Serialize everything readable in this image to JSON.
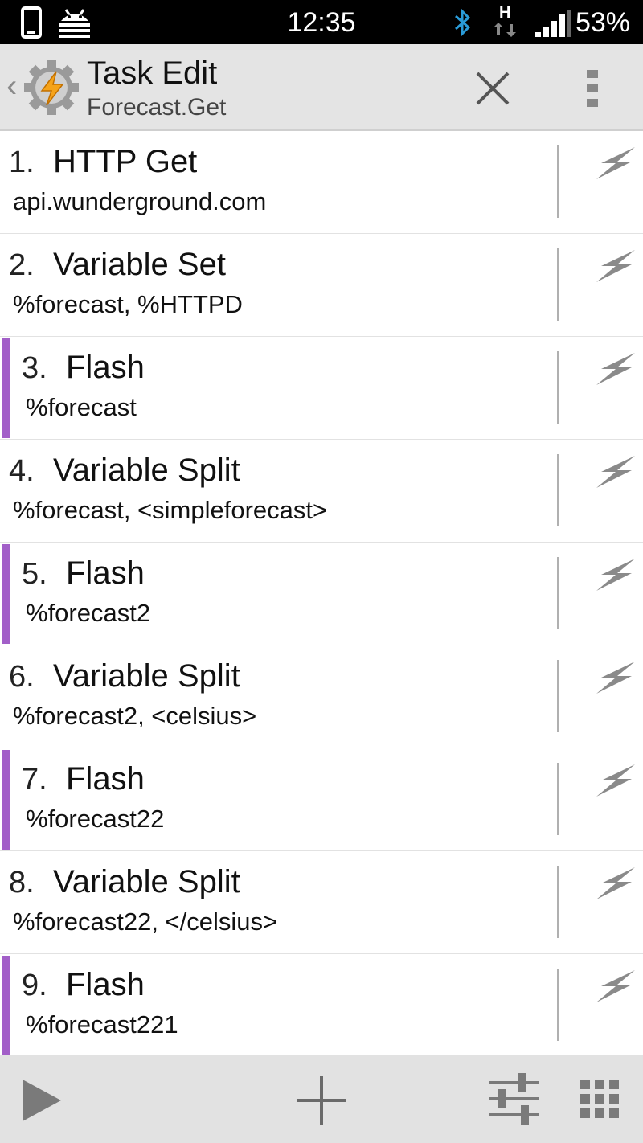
{
  "status": {
    "time": "12:35",
    "battery": "53%"
  },
  "header": {
    "title": "Task Edit",
    "subtitle": "Forecast.Get"
  },
  "accent_color": "#a25fc8",
  "actions": [
    {
      "number": "1.",
      "name": "HTTP Get",
      "detail": "api.wunderground.com",
      "flagged": false
    },
    {
      "number": "2.",
      "name": "Variable Set",
      "detail": "%forecast, %HTTPD",
      "flagged": false
    },
    {
      "number": "3.",
      "name": "Flash",
      "detail": "%forecast",
      "flagged": true
    },
    {
      "number": "4.",
      "name": "Variable Split",
      "detail": "%forecast, <simpleforecast>",
      "flagged": false
    },
    {
      "number": "5.",
      "name": "Flash",
      "detail": "%forecast2",
      "flagged": true
    },
    {
      "number": "6.",
      "name": "Variable Split",
      "detail": "%forecast2, <celsius>",
      "flagged": false
    },
    {
      "number": "7.",
      "name": "Flash",
      "detail": "%forecast22",
      "flagged": true
    },
    {
      "number": "8.",
      "name": "Variable Split",
      "detail": "%forecast22, </celsius>",
      "flagged": false
    },
    {
      "number": "9.",
      "name": "Flash",
      "detail": "%forecast221",
      "flagged": true
    }
  ],
  "icons": {
    "close": "close-icon",
    "overflow": "overflow-menu-icon",
    "action_bolt": "lightning-bolt-icon",
    "play": "play-icon",
    "add": "plus-icon",
    "settings": "sliders-icon",
    "grid": "grid-icon"
  }
}
